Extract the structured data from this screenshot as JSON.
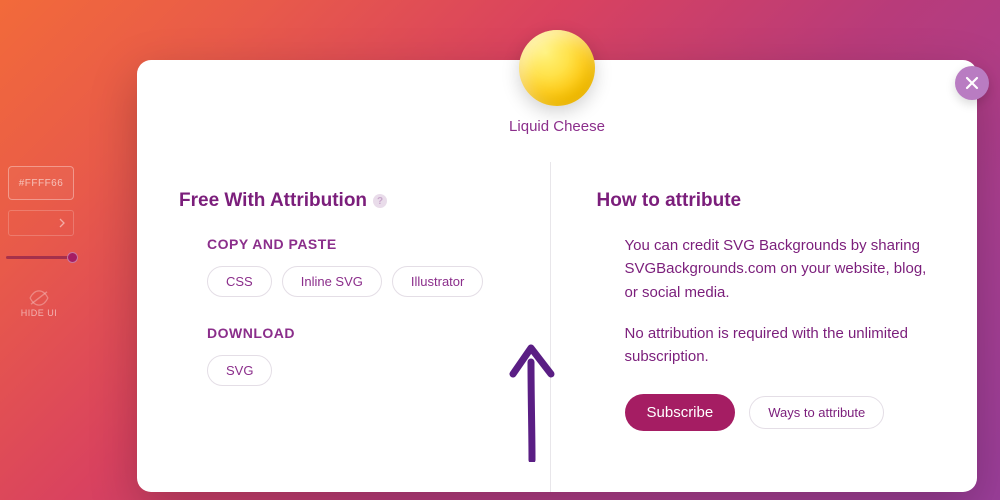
{
  "side": {
    "color_value": "#FFFF66",
    "hide_label": "HIDE UI"
  },
  "modal": {
    "title": "Liquid Cheese",
    "left": {
      "heading": "Free With Attribution",
      "copy_section": "COPY AND PASTE",
      "copy_buttons": {
        "css": "CSS",
        "inline_svg": "Inline SVG",
        "illustrator": "Illustrator"
      },
      "download_section": "DOWNLOAD",
      "download_buttons": {
        "svg": "SVG"
      }
    },
    "right": {
      "heading": "How to attribute",
      "p1": "You can credit SVG Backgrounds by sharing SVGBackgrounds.com on your website, blog, or social media.",
      "p2": "No attribution is required with the unlimited subscription.",
      "subscribe": "Subscribe",
      "ways": "Ways to attribute"
    }
  }
}
